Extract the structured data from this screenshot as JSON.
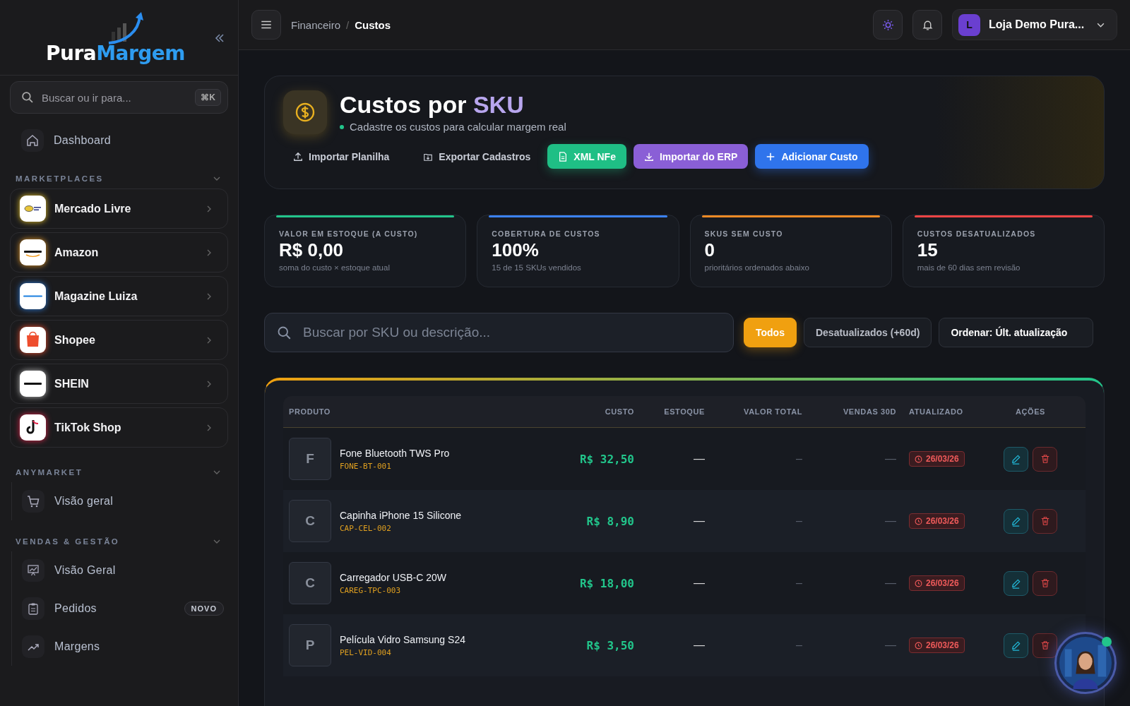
{
  "sidebar": {
    "logo": {
      "first": "Pura",
      "second": "Margem"
    },
    "search": {
      "placeholder": "Buscar ou ir para...",
      "shortcut": "⌘K"
    },
    "top_items": [
      {
        "label": "Dashboard"
      }
    ],
    "sections": [
      {
        "title": "MARKETPLACES",
        "expanded": true,
        "kind": "marketplace",
        "items": [
          {
            "label": "Mercado Livre"
          },
          {
            "label": "Amazon"
          },
          {
            "label": "Magazine Luiza"
          },
          {
            "label": "Shopee"
          },
          {
            "label": "SHEIN"
          },
          {
            "label": "TikTok Shop"
          }
        ]
      },
      {
        "title": "ANYMARKET",
        "expanded": true,
        "kind": "nav",
        "items": [
          {
            "label": "Visão geral"
          }
        ]
      },
      {
        "title": "VENDAS & GESTÃO",
        "expanded": true,
        "kind": "nav",
        "items": [
          {
            "label": "Visão Geral"
          },
          {
            "label": "Pedidos",
            "badge": "NOVO"
          },
          {
            "label": "Margens"
          }
        ]
      }
    ]
  },
  "header": {
    "breadcrumb": [
      {
        "label": "Financeiro",
        "current": false
      },
      {
        "label": "Custos",
        "current": true
      }
    ],
    "separator": "/",
    "account": {
      "initial": "L",
      "name": "Loja Demo Pura..."
    }
  },
  "hero": {
    "title": "Custos por ",
    "title_highlight": "SKU",
    "subtitle": "Cadastre os custos para calcular margem real",
    "actions": [
      {
        "label": "Importar Planilha",
        "kind": "ghost"
      },
      {
        "label": "Exportar Cadastros",
        "kind": "ghost"
      },
      {
        "label": "XML NFe",
        "kind": "green"
      },
      {
        "label": "Importar do ERP",
        "kind": "purple"
      },
      {
        "label": "Adicionar Custo",
        "kind": "blue"
      }
    ]
  },
  "stats": [
    {
      "label": "VALOR EM ESTOQUE (A CUSTO)",
      "value": "R$ 0,00",
      "note": "soma do custo × estoque atual",
      "color": "#22c58b"
    },
    {
      "label": "COBERTURA DE CUSTOS",
      "value": "100%",
      "note": "15 de 15 SKUs vendidos",
      "color": "#3b82f6"
    },
    {
      "label": "SKUS SEM CUSTO",
      "value": "0",
      "note": "prioritários ordenados abaixo",
      "color": "#f08a24"
    },
    {
      "label": "CUSTOS DESATUALIZADOS",
      "value": "15",
      "note": "mais de 60 dias sem revisão",
      "color": "#ef4444"
    }
  ],
  "filters": {
    "search": {
      "placeholder": "Buscar por SKU ou descrição..."
    },
    "chips": [
      {
        "label": "Todos",
        "selected": true
      },
      {
        "label": "Desatualizados (+60d)",
        "selected": false
      }
    ],
    "sort": "Ordenar: Últ. atualização"
  },
  "table": {
    "columns": [
      "PRODUTO",
      "CUSTO",
      "ESTOQUE",
      "VALOR TOTAL",
      "VENDAS 30D",
      "ATUALIZADO",
      "AÇÕES"
    ],
    "rows": [
      {
        "initial": "F",
        "name": "Fone Bluetooth TWS Pro",
        "sku": "FONE-BT-001",
        "cost": "R$ 32,50",
        "stock": "—",
        "total": "–",
        "sales": "—",
        "updated": "26/03/26",
        "stale": true
      },
      {
        "initial": "C",
        "name": "Capinha iPhone 15 Silicone",
        "sku": "CAP-CEL-002",
        "cost": "R$ 8,90",
        "stock": "—",
        "total": "–",
        "sales": "—",
        "updated": "26/03/26",
        "stale": true
      },
      {
        "initial": "C",
        "name": "Carregador USB-C 20W",
        "sku": "CAREG-TPC-003",
        "cost": "R$ 18,00",
        "stock": "—",
        "total": "–",
        "sales": "—",
        "updated": "26/03/26",
        "stale": true
      },
      {
        "initial": "P",
        "name": "Película Vidro Samsung S24",
        "sku": "PEL-VID-004",
        "cost": "R$ 3,50",
        "stock": "—",
        "total": "–",
        "sales": "—",
        "updated": "26/03/26",
        "stale": true
      }
    ]
  },
  "assistant": {
    "online": true
  }
}
